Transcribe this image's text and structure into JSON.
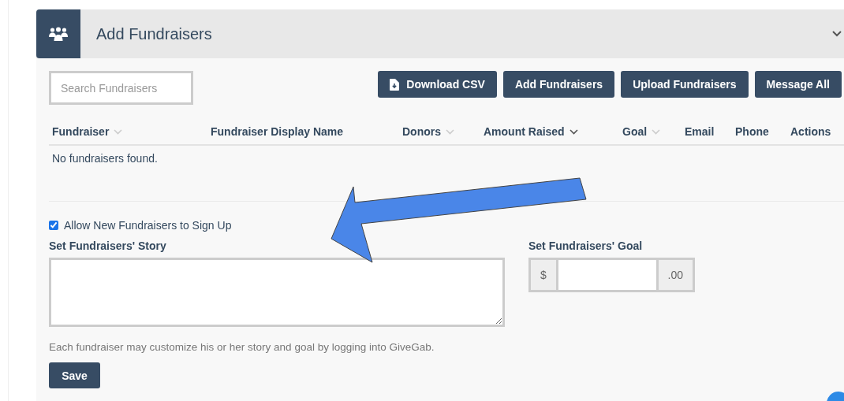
{
  "panel": {
    "title": "Add Fundraisers"
  },
  "search": {
    "placeholder": "Search Fundraisers"
  },
  "buttons": [
    {
      "label": "Download CSV",
      "kind": "download"
    },
    {
      "label": "Add Fundraisers",
      "kind": "plain"
    },
    {
      "label": "Upload Fundraisers",
      "kind": "plain"
    },
    {
      "label": "Message All",
      "kind": "plain"
    }
  ],
  "table": {
    "columns": [
      {
        "label": "Fundraiser",
        "kind": "sortable",
        "sorted": false
      },
      {
        "label": "Fundraiser Display Name",
        "kind": "plain",
        "sorted": false
      },
      {
        "label": "Donors",
        "kind": "sortable",
        "sorted": false
      },
      {
        "label": "Amount Raised",
        "kind": "sortable",
        "sorted": true
      },
      {
        "label": "Goal",
        "kind": "sortable",
        "sorted": false
      },
      {
        "label": "Email",
        "kind": "plain",
        "sorted": false
      },
      {
        "label": "Phone",
        "kind": "plain",
        "sorted": false
      },
      {
        "label": "Actions",
        "kind": "plain",
        "sorted": false
      }
    ],
    "empty_message": "No fundraisers found."
  },
  "allow_signup": {
    "label": "Allow New Fundraisers to Sign Up",
    "checked": true
  },
  "story": {
    "label": "Set Fundraisers' Story"
  },
  "goal": {
    "label": "Set Fundraisers' Goal",
    "prefix": "$",
    "suffix": ".00"
  },
  "help_text": "Each fundraiser may customize his or her story and goal by logging into GiveGab.",
  "save_button": "Save"
}
